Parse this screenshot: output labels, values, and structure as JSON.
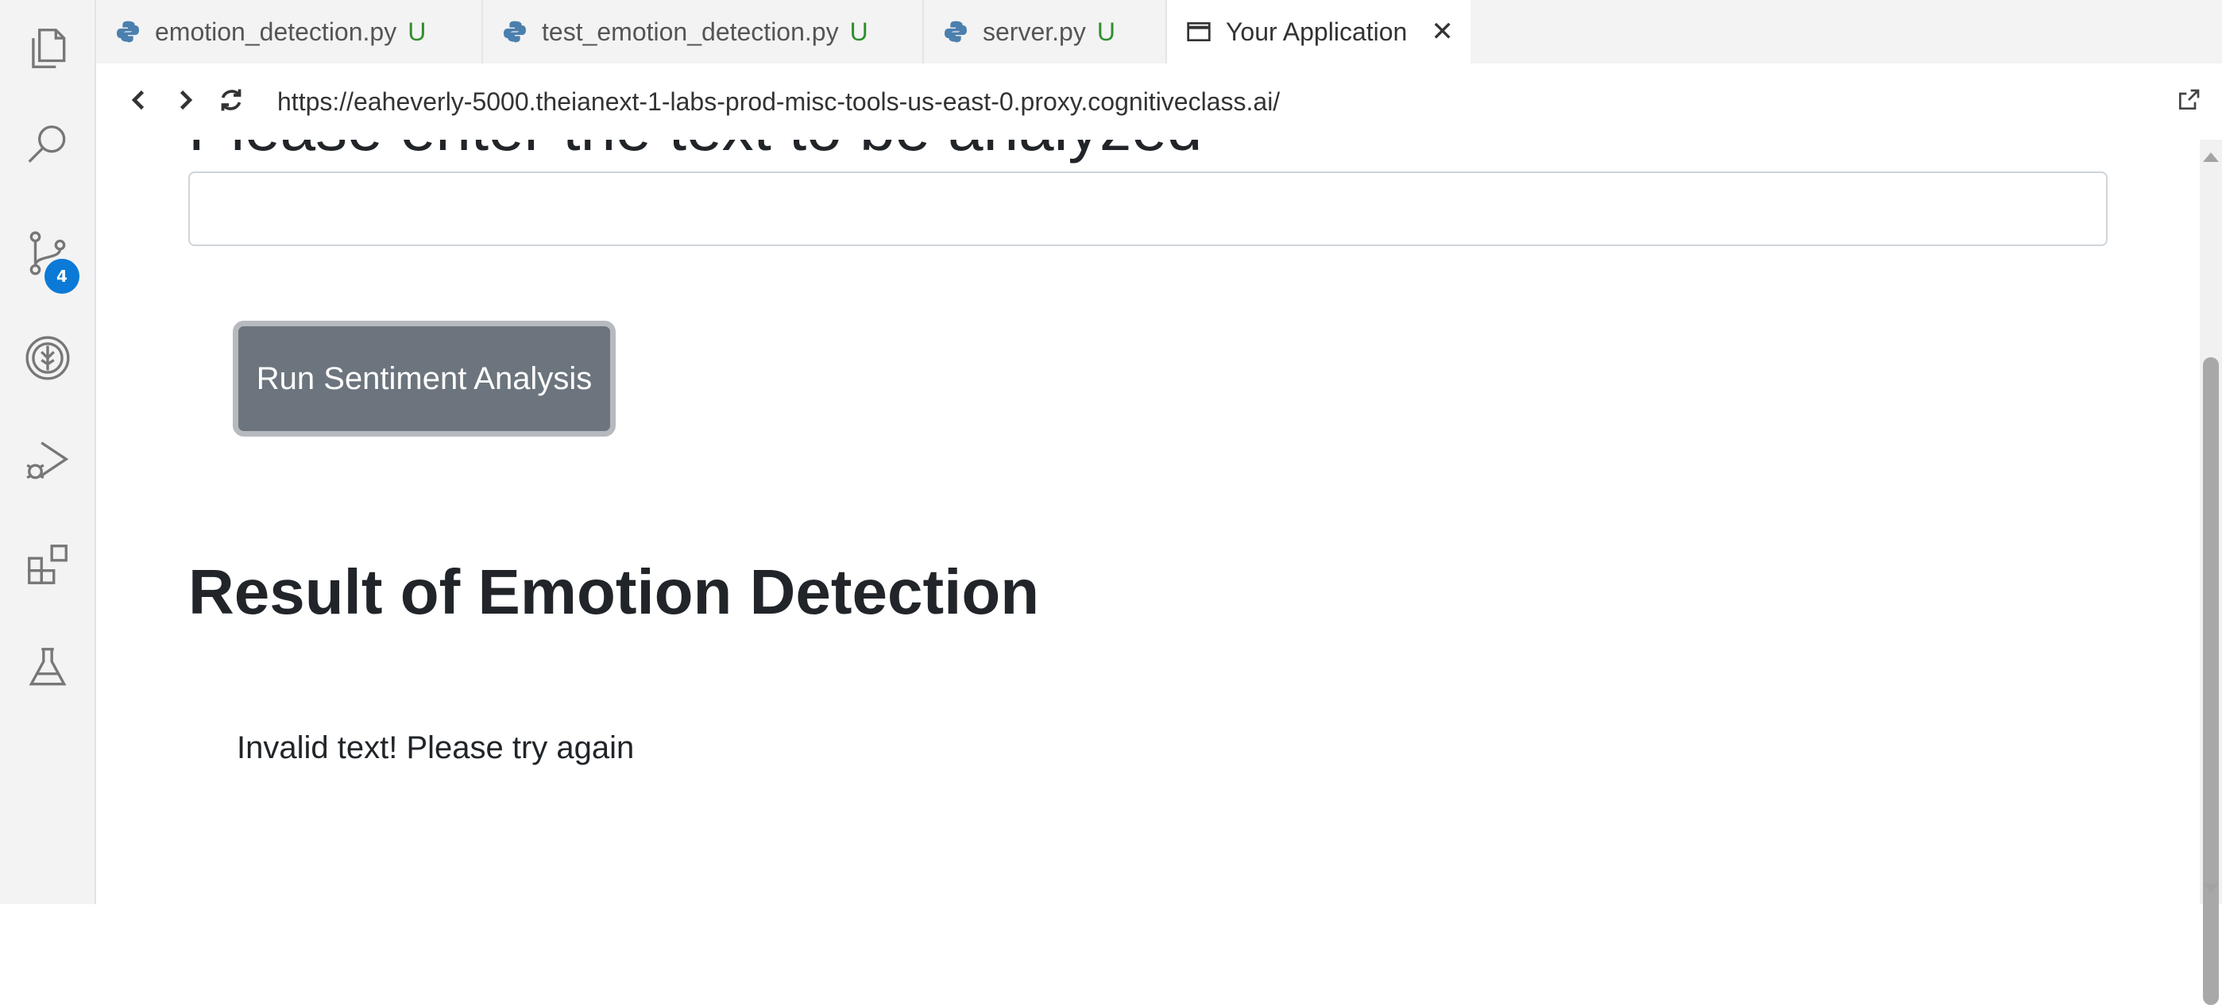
{
  "activity_bar": {
    "icons": [
      "explorer-icon",
      "search-icon",
      "source-control-icon",
      "skills-network-icon",
      "run-debug-icon",
      "extensions-icon",
      "testing-icon"
    ],
    "source_control_badge": "4"
  },
  "tabs": [
    {
      "label": "emotion_detection.py",
      "status": "U",
      "icon": "python-icon"
    },
    {
      "label": "test_emotion_detection.py",
      "status": "U",
      "icon": "python-icon"
    },
    {
      "label": "server.py",
      "status": "U",
      "icon": "python-icon"
    },
    {
      "label": "Your Application",
      "icon": "browser-window-icon",
      "close": "✕"
    }
  ],
  "browser": {
    "url": "https://eaheverly-5000.theianext-1-labs-prod-misc-tools-us-east-0.proxy.cognitiveclass.ai/"
  },
  "page": {
    "prompt_heading": "Please enter the text to be analyzed",
    "input_value": "",
    "run_button": "Run Sentiment Analysis",
    "result_heading": "Result of Emotion Detection",
    "result_text": "Invalid text! Please try again"
  },
  "colors": {
    "button_bg": "#6c757d",
    "badge": "#0a7ad6",
    "untracked": "#2f8f2f"
  }
}
